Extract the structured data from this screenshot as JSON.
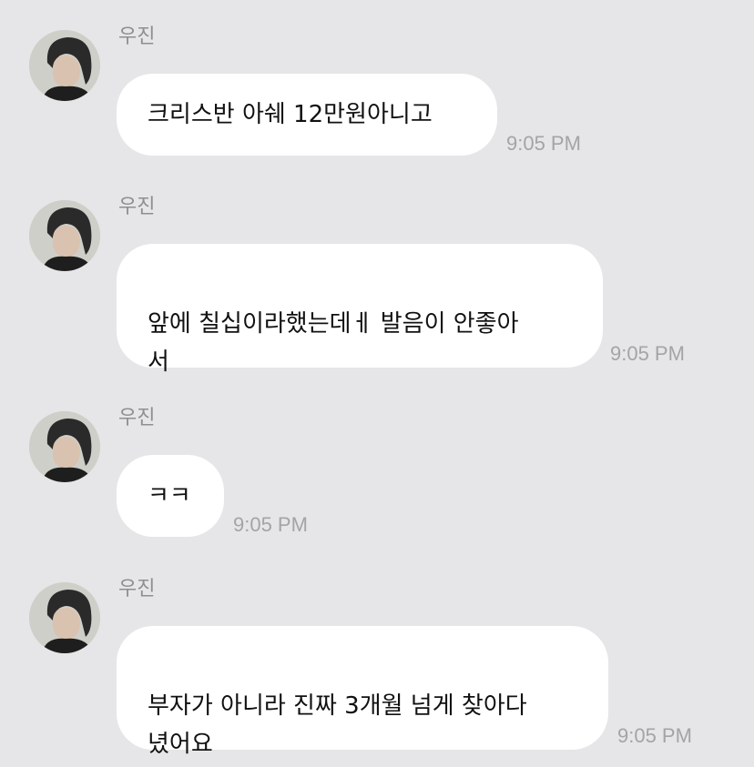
{
  "messages": [
    {
      "sender": "우진",
      "text": "크리스반 아쉐 12만원아니고",
      "time": "9:05 PM"
    },
    {
      "sender": "우진",
      "text": "앞에 칠십이라했는데ㅔ  발음이 안좋아\n서",
      "time": "9:05 PM"
    },
    {
      "sender": "우진",
      "text": "ㅋㅋ",
      "time": "9:05 PM"
    },
    {
      "sender": "우진",
      "text": "부자가 아니라 진짜 3개월 넘게 찾아다\n녔어요",
      "time": "9:05 PM"
    }
  ],
  "colors": {
    "background": "#e6e6e8",
    "bubble": "#ffffff",
    "sender_text": "#8e8e93",
    "timestamp": "#a4a4a8"
  }
}
